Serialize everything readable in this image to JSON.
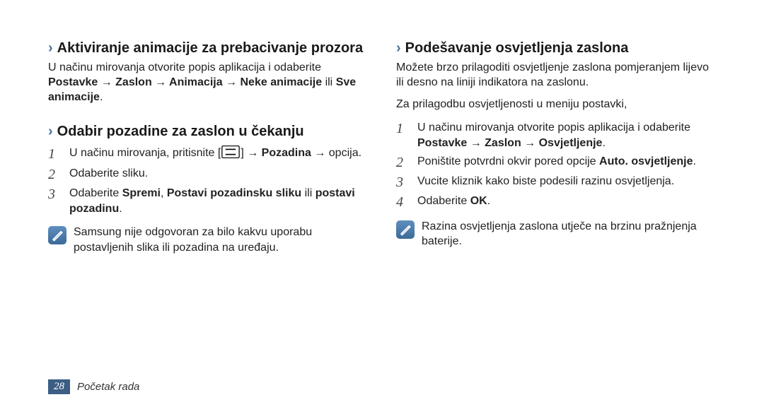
{
  "left": {
    "h1": "Aktiviranje animacije za prebacivanje prozora",
    "p1_a": "U načinu mirovanja otvorite popis aplikacija i odaberite ",
    "p1_b": "Postavke → Zaslon → Animacija → Neke animacije",
    "p1_c": " ili ",
    "p1_d": "Sve animacije",
    "p1_e": ".",
    "h2": "Odabir pozadine za zaslon u čekanju",
    "s1_a": "U načinu mirovanja, pritisnite [",
    "s1_b": "] → ",
    "s1_c": "Pozadina",
    "s1_d": " → opcija.",
    "s2": "Odaberite sliku.",
    "s3_a": "Odaberite ",
    "s3_b": "Spremi",
    "s3_c": ", ",
    "s3_d": "Postavi pozadinsku sliku",
    "s3_e": " ili ",
    "s3_f": "postavi pozadinu",
    "s3_g": ".",
    "note": "Samsung nije odgovoran za bilo kakvu uporabu postavljenih slika ili pozadina na uređaju."
  },
  "right": {
    "h1": "Podešavanje osvjetljenja zaslona",
    "p1": "Možete brzo prilagoditi osvjetljenje zaslona pomjeranjem lijevo ili desno na liniji indikatora na zaslonu.",
    "p2": "Za prilagodbu osvjetljenosti u meniju postavki,",
    "s1_a": "U načinu mirovanja otvorite popis aplikacija i odaberite ",
    "s1_b": "Postavke → Zaslon → Osvjetljenje",
    "s1_c": ".",
    "s2_a": "Poništite potvrdni okvir pored opcije ",
    "s2_b": "Auto. osvjetljenje",
    "s2_c": ".",
    "s3": "Vucite kliznik kako biste podesili razinu osvjetljenja.",
    "s4_a": "Odaberite ",
    "s4_b": "OK",
    "s4_c": ".",
    "note": "Razina osvjetljenja zaslona utječe na brzinu pražnjenja baterije."
  },
  "footer": {
    "page": "28",
    "label": "Početak rada"
  }
}
